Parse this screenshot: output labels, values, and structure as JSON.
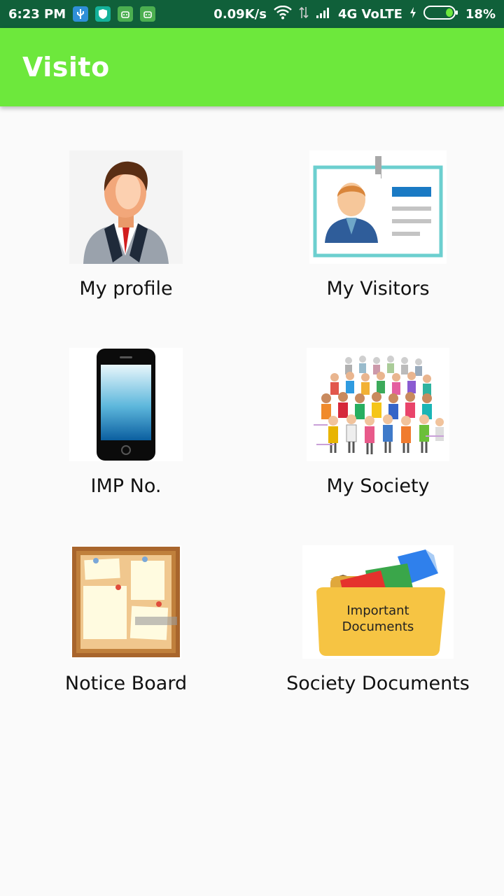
{
  "status_bar": {
    "time": "6:23 PM",
    "net_speed": "0.09K/s",
    "network": "4G VoLTE",
    "battery": "18%",
    "icons": [
      "usb-icon",
      "shield-icon",
      "android-icon",
      "android-icon",
      "wifi-icon",
      "data-arrows-icon",
      "signal-icon",
      "charging-icon",
      "battery-icon"
    ]
  },
  "app_bar": {
    "title": "Visito"
  },
  "menu": [
    {
      "label": "My profile",
      "icon": "profile-avatar-icon"
    },
    {
      "label": "My Visitors",
      "icon": "id-card-icon"
    },
    {
      "label": "IMP No.",
      "icon": "smartphone-icon"
    },
    {
      "label": "My Society",
      "icon": "crowd-icon"
    },
    {
      "label": "Notice Board",
      "icon": "corkboard-icon"
    },
    {
      "label": "Society Documents",
      "icon": "folder-icon",
      "folder_text": [
        "Important",
        "Documents"
      ]
    }
  ],
  "colors": {
    "status_bar": "#10603a",
    "app_bar": "#6de83c",
    "background": "#fafafa"
  }
}
